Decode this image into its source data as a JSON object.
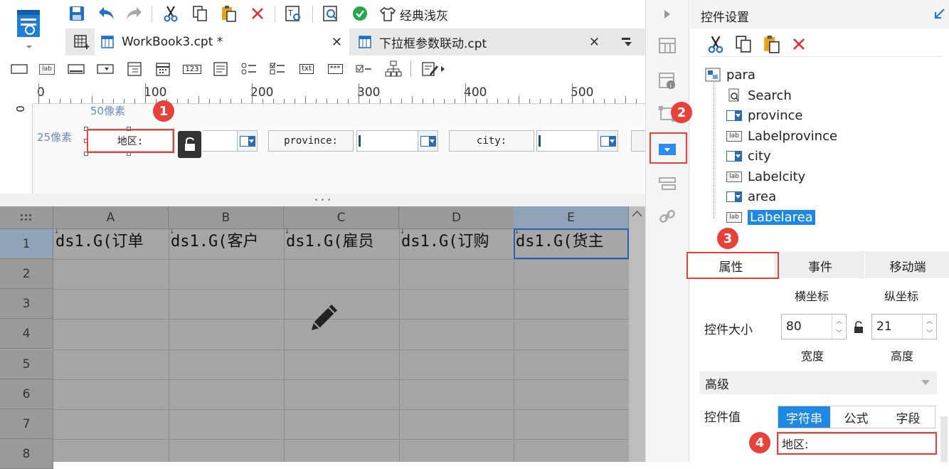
{
  "toolbar": {
    "icons": [
      "save-icon",
      "undo-icon",
      "redo-icon",
      "cut-icon",
      "copy-icon",
      "paste-icon",
      "delete-icon",
      "text-search-icon",
      "preview-search-icon",
      "check-icon",
      "theme-shirt-icon"
    ],
    "theme_label": "经典浅灰"
  },
  "tabs": [
    {
      "label": "WorkBook3.cpt *",
      "active": true
    },
    {
      "label": "下拉框参数联动.cpt",
      "active": false
    }
  ],
  "control_bar": {
    "icons": [
      "textbox-icon",
      "label-icon",
      "button-icon",
      "combobox-icon",
      "treecombo-icon",
      "date-icon",
      "number-icon",
      "textarea-icon",
      "radio-group-icon",
      "checkbox-group-icon",
      "txt-icon",
      "password-icon",
      "checkbox-icon",
      "tree-icon",
      "edit-more-icon"
    ],
    "number_label": "123",
    "txt_label": "txt",
    "password_label": "***",
    "label_label": "lab"
  },
  "ruler": {
    "ticks": [
      "0",
      "100",
      "200",
      "300",
      "400",
      "500"
    ],
    "vertical_tick": "0"
  },
  "para_pane": {
    "hint_50": "50像素",
    "hint_25": "25像素",
    "widgets": {
      "area_label": "地区:",
      "province_label": "province:",
      "city_label": "city:"
    }
  },
  "grid": {
    "columns": [
      "A",
      "B",
      "C",
      "D",
      "E"
    ],
    "rows": [
      "1",
      "2",
      "3",
      "4",
      "5",
      "6",
      "7",
      "8"
    ],
    "row1": [
      "ds1.G(订单",
      "ds1.G(客户",
      "ds1.G(雇员",
      "ds1.G(订购",
      "ds1.G(货主"
    ],
    "bg_color": "#a6a6a6"
  },
  "side_strip": {
    "icons": [
      "expand-arrow-icon",
      "layout-icon",
      "widget-info-icon",
      "frame-icon",
      "combobox-widget-icon",
      "form-list-icon",
      "link-icon"
    ]
  },
  "panel": {
    "title": "控件设置",
    "tools": [
      "cut-icon",
      "copy-icon",
      "paste-icon",
      "delete-icon"
    ],
    "tree": [
      {
        "label": "para",
        "icon": "para-icon"
      },
      {
        "label": "Search",
        "icon": "search-doc-icon"
      },
      {
        "label": "province",
        "icon": "combobox-icon"
      },
      {
        "label": "Labelprovince",
        "icon": "label-icon"
      },
      {
        "label": "city",
        "icon": "combobox-icon"
      },
      {
        "label": "Labelcity",
        "icon": "label-icon"
      },
      {
        "label": "area",
        "icon": "combobox-icon"
      },
      {
        "label": "Labelarea",
        "icon": "label-icon",
        "selected": true
      }
    ],
    "tabs": [
      "属性",
      "事件",
      "移动端"
    ],
    "coord_x_label": "横坐标",
    "coord_y_label": "纵坐标",
    "size_label": "控件大小",
    "width_value": "80",
    "height_value": "21",
    "width_label": "宽度",
    "height_label": "高度",
    "advanced_label": "高级",
    "value_label": "控件值",
    "value_tabs": [
      "字符串",
      "公式",
      "字段"
    ],
    "value_text": "地区:"
  },
  "annotations": [
    "1",
    "2",
    "3",
    "4"
  ],
  "colors": {
    "accent": "#1e88e5",
    "badge": "#e8413a",
    "selected": "#1e88e5"
  }
}
